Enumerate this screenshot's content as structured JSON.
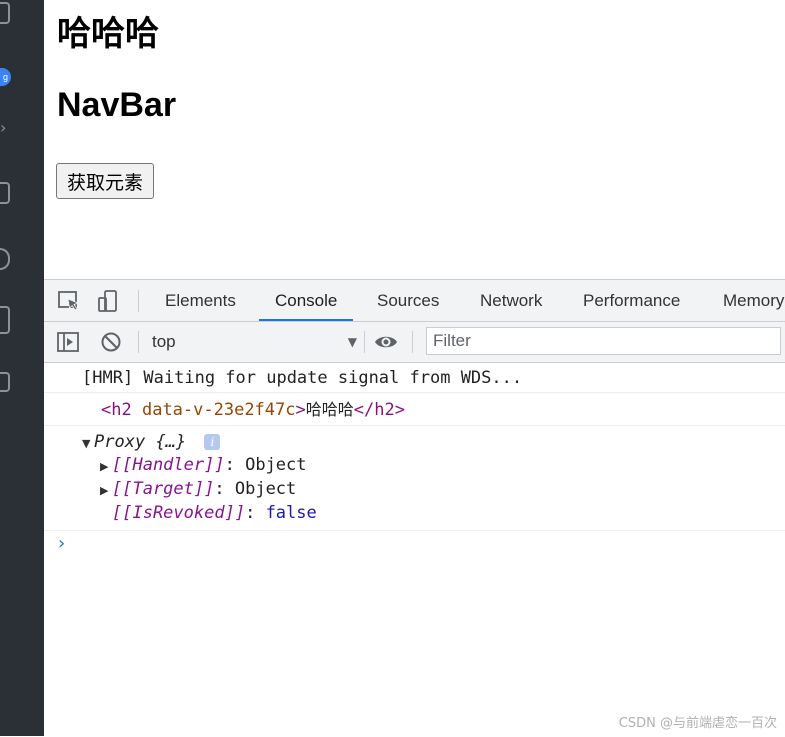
{
  "page": {
    "heading_chinese": "哈哈哈",
    "heading_navbar": "NavBar",
    "button_label": "获取元素"
  },
  "devtools": {
    "tabs": [
      "Elements",
      "Console",
      "Sources",
      "Network",
      "Performance",
      "Memory"
    ],
    "active_tab": "Console",
    "context": "top",
    "filter_placeholder": "Filter",
    "console_lines": {
      "hmr": "[HMR] Waiting for update signal from WDS...",
      "element": {
        "open_tag": "<h2",
        "attr": "data-v-23e2f47c",
        "close_bracket": ">",
        "text": "哈哈哈",
        "end_tag": "</h2>"
      },
      "proxy": {
        "label": "Proxy",
        "preview": "{…}",
        "info": "i",
        "handler_key": "[[Handler]]",
        "handler_val": "Object",
        "target_key": "[[Target]]",
        "target_val": "Object",
        "revoked_key": "[[IsRevoked]]",
        "revoked_val": "false",
        "colon": ":"
      }
    },
    "prompt": "›"
  },
  "activity_bar": {
    "badge": "g"
  },
  "watermark": "CSDN @与前端虐恋一百次",
  "colors": {
    "accent": "#1a73e8",
    "activity_bar": "#2b2f36",
    "tag": "#881280",
    "attr": "#994500",
    "keyword": "#1a1aa6"
  }
}
